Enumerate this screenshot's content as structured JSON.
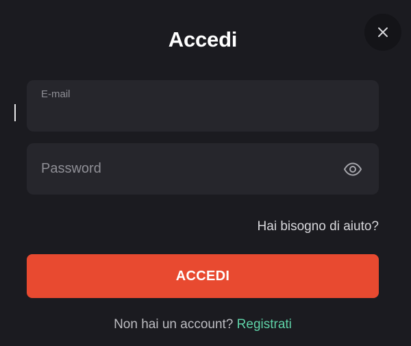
{
  "modal": {
    "title": "Accedi",
    "close_icon": "close-icon"
  },
  "email": {
    "label": "E-mail",
    "value": ""
  },
  "password": {
    "placeholder": "Password",
    "value": "",
    "toggle_icon": "eye-icon"
  },
  "help_link": "Hai bisogno di aiuto?",
  "submit_label": "ACCEDI",
  "signup": {
    "prompt": "Non hai un account?",
    "link": "Registrati"
  },
  "colors": {
    "background": "#1b1b20",
    "field": "#26262c",
    "accent": "#e84a30",
    "link": "#5fd3a8"
  }
}
